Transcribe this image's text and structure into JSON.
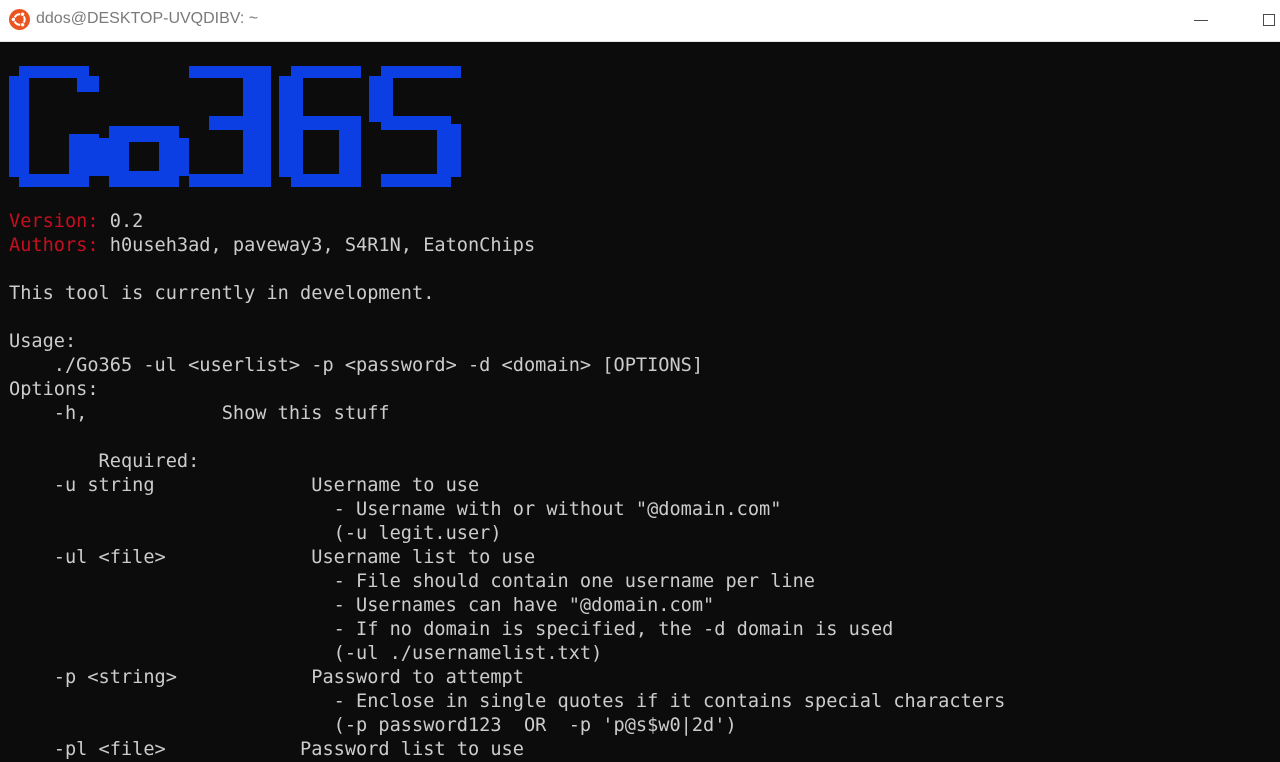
{
  "titlebar": {
    "title": "ddos@DESKTOP-UVQDIBV: ~",
    "icon": "ubuntu-icon",
    "accent_color": "#e95420"
  },
  "terminal": {
    "banner_text": "Go365",
    "banner_color": "#0b3fe3",
    "label_color": "#c50f1f",
    "text_color": "#cccccc",
    "background": "#0c0c0c",
    "version_label": "Version:",
    "version_value": " 0.2",
    "authors_label": "Authors:",
    "authors_value": " h0useh3ad, paveway3, S4R1N, EatonChips",
    "lines": {
      "dev_notice": "This tool is currently in development.",
      "usage_header": "Usage:",
      "usage_cmd": "    ./Go365 -ul <userlist> -p <password> -d <domain> [OPTIONS]",
      "options_header": "Options:",
      "opt_h": "    -h,            Show this stuff",
      "required_header": "        Required:",
      "opt_u": "    -u string              Username to use",
      "opt_u_d1": "                             - Username with or without \"@domain.com\"",
      "opt_u_d2": "                             (-u legit.user)",
      "opt_ul": "    -ul <file>             Username list to use",
      "opt_ul_d1": "                             - File should contain one username per line",
      "opt_ul_d2": "                             - Usernames can have \"@domain.com\"",
      "opt_ul_d3": "                             - If no domain is specified, the -d domain is used",
      "opt_ul_d4": "                             (-ul ./usernamelist.txt)",
      "opt_p": "    -p <string>            Password to attempt",
      "opt_p_d1": "                             - Enclose in single quotes if it contains special characters",
      "opt_p_d2": "                             (-p password123  OR  -p 'p@s$w0|2d')",
      "opt_pl": "    -pl <file>            Password list to use"
    }
  }
}
